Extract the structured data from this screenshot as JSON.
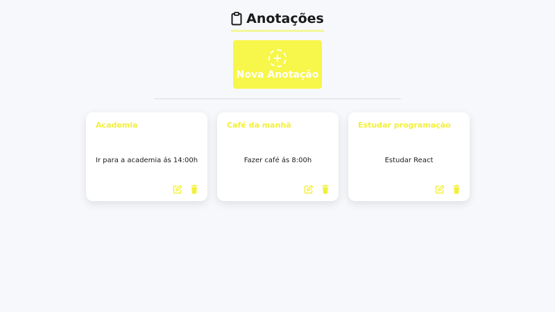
{
  "header": {
    "title": "Anotações",
    "icon": "clipboard-icon"
  },
  "new_note": {
    "label": "Nova Anotação",
    "icon": "plus-circle-icon"
  },
  "notes": [
    {
      "title": "Academia",
      "text": "Ir para a academia ás 14:00h"
    },
    {
      "title": "Café da manhã",
      "text": "Fazer café ás 8:00h"
    },
    {
      "title": "Estudar programação",
      "text": "Estudar React"
    }
  ],
  "colors": {
    "accent": "#f7f64a",
    "card_title": "#f2f03a",
    "background": "#f6f8fb"
  },
  "icons": {
    "edit": "edit-icon",
    "delete": "trash-icon"
  }
}
